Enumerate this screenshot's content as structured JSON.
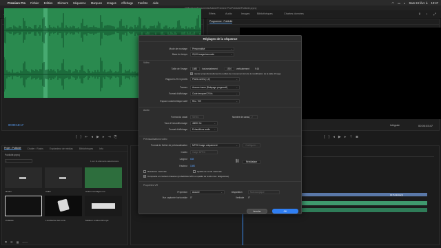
{
  "menubar": {
    "app_name": "Premiere Pro",
    "items": [
      "Fichier",
      "Edition",
      "Elément",
      "Séquence",
      "Marques",
      "Images",
      "Affichage",
      "Fenêtre",
      "Aide"
    ],
    "date": "Sam 24 févr. à",
    "time": "13:47"
  },
  "titlebar": {
    "text": "/Utilisateurs/Documents/Adobe/Premiere Pro/Publicité/Publicité.prproj"
  },
  "workspace": {
    "tabs": [
      "Formation",
      "Assemblage",
      "Montage",
      "Couleur",
      "Effets",
      "Audio",
      "Images",
      "Bibliothèques",
      "Chartes données"
    ],
    "active": "Montage"
  },
  "source_panel": {
    "tabs": [
      "Source : Heartbeat sound.mp3",
      "Options d'effet",
      "Mixage des éléments audio : Publicité",
      "Métadonnées"
    ],
    "timecode": "00:00:18:17"
  },
  "program_panel": {
    "tab": "Programme : Publicité",
    "fit": "Intégrale",
    "timecode": "00:00:03:47"
  },
  "project_panel": {
    "tabs": [
      "Projet : Publicité",
      "Chutier : Rushs",
      "Explorateur de médias",
      "Bibliothèques",
      "Info"
    ],
    "project_file": "Publicité.prproj",
    "item_count": "1 sur 11 éléments sélectionnés",
    "items": [
      {
        "name": "Rushs",
        "meta": "3 éléments"
      },
      {
        "name": "Vidéo",
        "meta": "5 éléments"
      },
      {
        "name": "Autres montages.mo",
        "meta": "6:21"
      },
      {
        "name": "Publicité",
        "meta": "14:40"
      },
      {
        "name": "L'ambiance des sons",
        "meta": "4:00"
      },
      {
        "name": "Meilleur à video FR.mp4",
        "meta": "4:06"
      }
    ]
  },
  "dialog": {
    "title": "Réglages de la séquence",
    "mode_montage_label": "Mode de montage",
    "mode_montage_value": "Personnalisé",
    "base_temps_label": "Base de temps",
    "base_temps_value": "25,00 images/seconde",
    "video_section": "Vidéo",
    "taille_label": "Taille de l'image",
    "width": "1080",
    "horizontal_label": "horizontalement",
    "height": "1920",
    "vertical_label": "verticalement",
    "ratio": "9:16",
    "proportions_text": "Ajuster proportionnellement les effets de mouvement lors de la modification de la taille d'image",
    "format_pixels_label": "Rapport L/H en pixels",
    "format_pixels_value": "Pixels carrés (1,0)",
    "trame_label": "Trames",
    "trame_value": "Aucune trame (Balayage progressif)",
    "format_affichage_label": "Format d'affichage",
    "format_affichage_value": "Code temporel 25 i/s",
    "espace_label": "Espace colorimétrique actif",
    "espace_value": "Rec. 709",
    "audio_section": "Audio",
    "format_canal_label": "Format du canal",
    "format_canal_value": "Stéréo",
    "nb_canaux_label": "Nombre de canaux",
    "nb_canaux_value": "2",
    "echantillonnage_label": "Taux d'échantillonnage",
    "echantillonnage_value": "48000 Hz",
    "format_audio_label": "Format d'affichage",
    "format_audio_value": "Echantillons audio",
    "preview_section": "Prévisualisations vidéo",
    "preview_format_label": "Format de fichier de prévisualisation",
    "preview_format_value": "MPEG image uniquement",
    "configurer_label": "Configurer...",
    "codec_label": "Codec",
    "codec_value": "Image MPEG",
    "largeur_label": "Largeur",
    "largeur_value": "608",
    "hauteur_label": "Hauteur",
    "hauteur_value": "1080",
    "reinit_label": "Réinitialiser",
    "max_profondeur": "Résolution maximale",
    "qualite_max": "Qualité de rendu maximale",
    "composite_text": "Composite en couleurs linéaires (probabilités GPU ou qualité de rendu max. obligatoires)",
    "vr_section": "Propriétés VR",
    "projection_label": "Projection",
    "projection_value": "Aucune",
    "disposition_label": "Disposition",
    "disposition_value": "Monoscopique",
    "capture_h_label": "Vue capturée horizontale",
    "capture_h_value": "0°",
    "verticale_label": "Verticale",
    "verticale_value": "0°",
    "cancel": "Annuler",
    "ok": "OK"
  },
  "timeline": {
    "clip_label": "00 Publicité(1)"
  },
  "colors": {
    "waveform_bg": "#2a8a4f",
    "waveform_fg": "#0f4d2a",
    "accent": "#2f7ef2",
    "audio_clip": "#3f9a6e",
    "video_clip": "#5a78a8"
  }
}
